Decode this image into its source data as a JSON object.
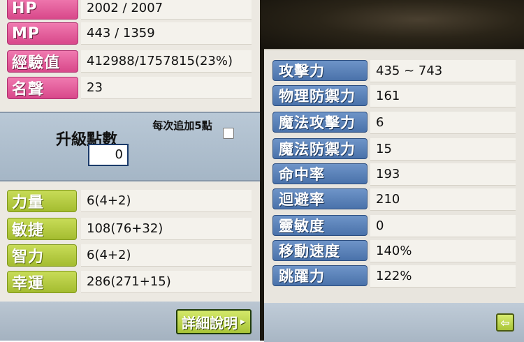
{
  "basic_stats": [
    {
      "label": "HP",
      "value": "2002 / 2007"
    },
    {
      "label": "MP",
      "value": "443 / 1359"
    },
    {
      "label": "經驗值",
      "value": "412988/1757815(23%)"
    },
    {
      "label": "名聲",
      "value": "23"
    }
  ],
  "ability_points": {
    "title": "升級點數",
    "value": "0",
    "add5_label": "每次追加5點"
  },
  "primary_stats": [
    {
      "label": "力量",
      "value": "6(4+2)"
    },
    {
      "label": "敏捷",
      "value": "108(76+32)"
    },
    {
      "label": "智力",
      "value": "6(4+2)"
    },
    {
      "label": "幸運",
      "value": "286(271+15)"
    }
  ],
  "detail_button": {
    "label": "詳細說明",
    "arrow": "▸"
  },
  "detail_stats": [
    {
      "label": "攻擊力",
      "value": "435 ~ 743"
    },
    {
      "label": "物理防禦力",
      "value": "161"
    },
    {
      "label": "魔法攻擊力",
      "value": "6"
    },
    {
      "label": "魔法防禦力",
      "value": "15"
    },
    {
      "label": "命中率",
      "value": "193"
    },
    {
      "label": "迴避率",
      "value": "210"
    },
    {
      "label": "靈敏度",
      "value": "0"
    },
    {
      "label": "移動速度",
      "value": "140%"
    },
    {
      "label": "跳躍力",
      "value": "122%"
    }
  ],
  "back_button": {
    "icon": "back-arrow-icon",
    "glyph": "⇦"
  },
  "colors": {
    "pink_label": "#d8488a",
    "green_label": "#a4bc30",
    "blue_label": "#4a72aa",
    "panel_bg": "#ece9e2"
  }
}
